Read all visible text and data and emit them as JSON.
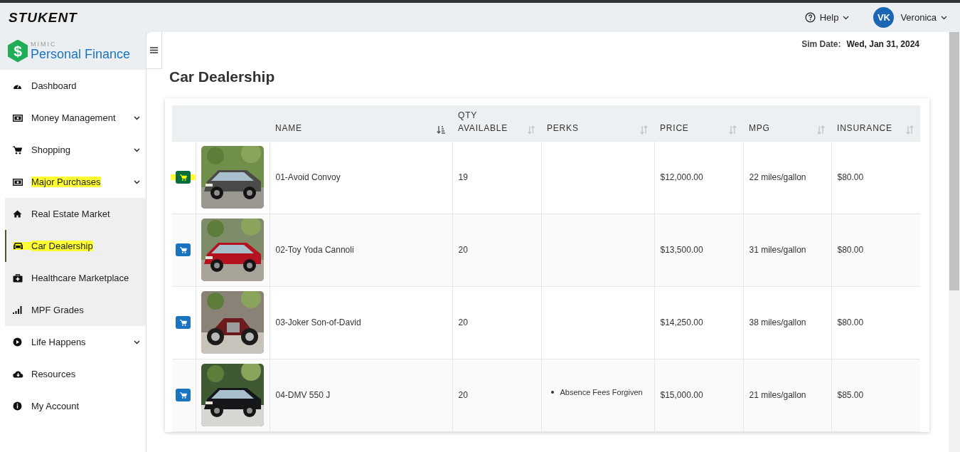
{
  "topbar": {
    "brand": "STUKENT",
    "help": "Help",
    "user_initials": "VK",
    "user_name": "Veronica"
  },
  "app_logo": {
    "badge": "$",
    "overline": "MIMIC",
    "title": "Personal Finance"
  },
  "sidebar": {
    "items": [
      {
        "label": "Dashboard",
        "expandable": false,
        "highlighted": false,
        "selected": false
      },
      {
        "label": "Money Management",
        "expandable": true,
        "highlighted": false,
        "selected": false
      },
      {
        "label": "Shopping",
        "expandable": true,
        "highlighted": false,
        "selected": false
      },
      {
        "label": "Major Purchases",
        "expandable": true,
        "highlighted": true,
        "selected": false,
        "children": [
          {
            "label": "Real Estate Market",
            "highlighted": false,
            "selected": false
          },
          {
            "label": "Car Dealership",
            "highlighted": true,
            "selected": true
          },
          {
            "label": "Healthcare Marketplace",
            "highlighted": false,
            "selected": false
          },
          {
            "label": "MPF Grades",
            "highlighted": false,
            "selected": false
          }
        ]
      },
      {
        "label": "Life Happens",
        "expandable": true,
        "highlighted": false,
        "selected": false
      },
      {
        "label": "Resources",
        "expandable": false,
        "highlighted": false,
        "selected": false
      },
      {
        "label": "My Account",
        "expandable": false,
        "highlighted": false,
        "selected": false
      }
    ]
  },
  "sim_date": {
    "label": "Sim Date:",
    "value": "Wed, Jan 31, 2024"
  },
  "page_title": "Car Dealership",
  "table": {
    "columns": [
      {
        "label": "NAME",
        "sorted": true
      },
      {
        "label": "QTY AVAILABLE",
        "sorted": false
      },
      {
        "label": "PERKS",
        "sorted": false
      },
      {
        "label": "PRICE",
        "sorted": false
      },
      {
        "label": "MPG",
        "sorted": false
      },
      {
        "label": "INSURANCE",
        "sorted": false
      }
    ],
    "rows": [
      {
        "cart_highlighted": true,
        "name": "01-Avoid Convoy",
        "qty": "19",
        "perks": [],
        "price": "$12,000.00",
        "mpg": "22 miles/gallon",
        "insurance": "$80.00"
      },
      {
        "cart_highlighted": false,
        "name": "02-Toy Yoda Cannoli",
        "qty": "20",
        "perks": [],
        "price": "$13,500.00",
        "mpg": "31 miles/gallon",
        "insurance": "$80.00"
      },
      {
        "cart_highlighted": false,
        "name": "03-Joker Son-of-David",
        "qty": "20",
        "perks": [],
        "price": "$14,250.00",
        "mpg": "38 miles/gallon",
        "insurance": "$80.00"
      },
      {
        "cart_highlighted": false,
        "name": "04-DMV 550 J",
        "qty": "20",
        "perks": [
          "Absence Fees Forgiven"
        ],
        "price": "$15,000.00",
        "mpg": "21 miles/gallon",
        "insurance": "$85.00"
      }
    ]
  }
}
